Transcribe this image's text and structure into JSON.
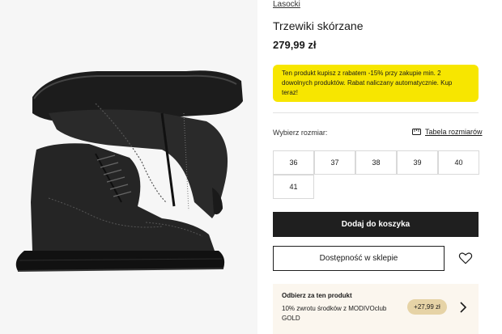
{
  "product": {
    "brand": "Lasocki",
    "title": "Trzewiki skórzane",
    "price": "279,99 zł"
  },
  "promo": {
    "text": "Ten produkt kupisz z rabatem -15% przy zakupie min. 2 dowolnych produktów. Rabat naliczany automatycznie. Kup teraz!",
    "color": "#f7e600"
  },
  "sizes": {
    "label": "Wybierz rozmiar:",
    "chart_link": "Tabela rozmiarów",
    "chart_icon": "ruler-icon",
    "options": [
      "36",
      "37",
      "38",
      "39",
      "40",
      "41"
    ]
  },
  "actions": {
    "add_to_cart": "Dodaj do koszyka",
    "store_availability": "Dostępność w sklepie",
    "wishlist_icon": "heart-icon"
  },
  "club": {
    "title": "Odbierz za ten produkt",
    "description": "10% zwrotu środków z MODIVOclub GOLD",
    "badge": "+27,99 zł",
    "chevron_icon": "chevron-right-icon"
  },
  "image": {
    "subject": "black-leather-brogue-boots-icon"
  }
}
